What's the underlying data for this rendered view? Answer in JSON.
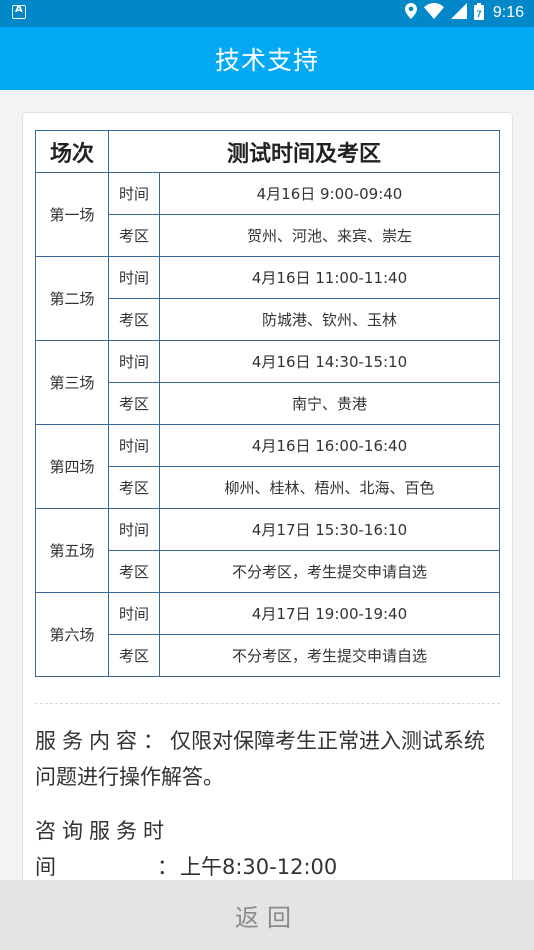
{
  "status_bar": {
    "time": "9:16",
    "battery_level": "7"
  },
  "header": {
    "title": "技术支持"
  },
  "table": {
    "col_session": "场次",
    "col_info": "测试时间及考区",
    "time_label": "时间",
    "area_label": "考区",
    "rows": [
      {
        "session": "第一场",
        "time": "4月16日 9:00-09:40",
        "area": "贺州、河池、来宾、崇左"
      },
      {
        "session": "第二场",
        "time": "4月16日 11:00-11:40",
        "area": "防城港、钦州、玉林"
      },
      {
        "session": "第三场",
        "time": "4月16日 14:30-15:10",
        "area": "南宁、贵港"
      },
      {
        "session": "第四场",
        "time": "4月16日 16:00-16:40",
        "area": "柳州、桂林、梧州、北海、百色"
      },
      {
        "session": "第五场",
        "time": "4月17日 15:30-16:10",
        "area": "不分考区，考生提交申请自选"
      },
      {
        "session": "第六场",
        "time": "4月17日 19:00-19:40",
        "area": "不分考区，考生提交申请自选"
      }
    ]
  },
  "service": {
    "label": "服务内容：",
    "text": "仅限对保障考生正常进入测试系统问题进行操作解答。",
    "hours_label_1": "咨询服务时",
    "hours_label_2": "间",
    "hours_colon": "：",
    "hours_value": "上午8:30-12:00"
  },
  "footer": {
    "back_label": "返回"
  }
}
